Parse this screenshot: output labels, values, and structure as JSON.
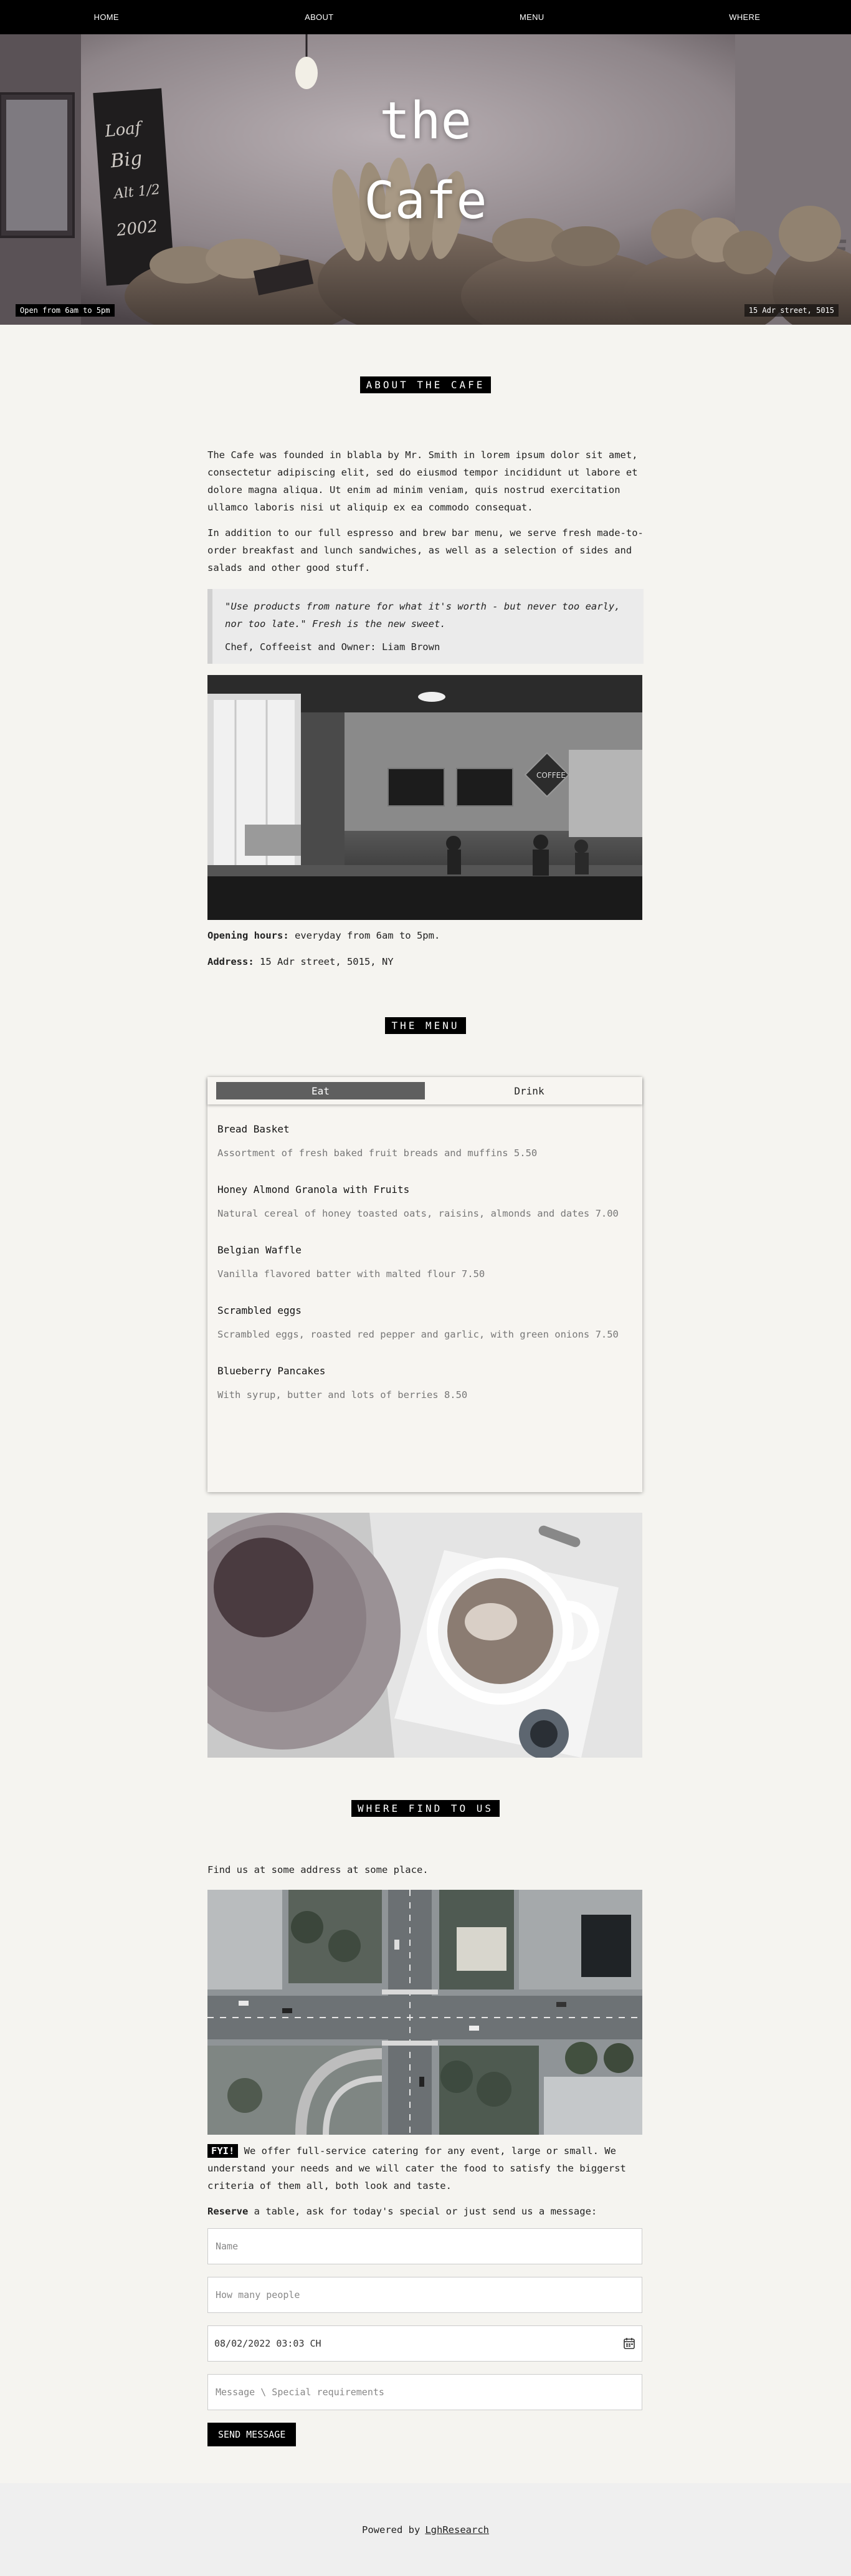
{
  "nav": {
    "home": "HOME",
    "about": "ABOUT",
    "menu": "MENU",
    "where": "WHERE"
  },
  "hero": {
    "title_line1": "the",
    "title_line2": "Cafe",
    "hours_badge": "Open from 6am to 5pm",
    "address_badge": "15 Adr street, 5015"
  },
  "about": {
    "heading": "ABOUT THE CAFE",
    "paragraph1": "The Cafe was founded in blabla by Mr. Smith in lorem ipsum dolor sit amet, consectetur adipiscing elit, sed do eiusmod tempor incididunt ut labore et dolore magna aliqua. Ut enim ad minim veniam, quis nostrud exercitation ullamco laboris nisi ut aliquip ex ea commodo consequat.",
    "paragraph2": "In addition to our full espresso and brew bar menu, we serve fresh made-to-order breakfast and lunch sandwiches, as well as a selection of sides and salads and other good stuff.",
    "quote": "\"Use products from nature for what it's worth - but never too early, nor too late.\" Fresh is the new sweet.",
    "quote_author": "Chef, Coffeeist and Owner: Liam Brown",
    "hours_label": "Opening hours:",
    "hours_value": "everyday from 6am to 5pm.",
    "address_label": "Address:",
    "address_value": "15 Adr street, 5015, NY"
  },
  "menu": {
    "heading": "THE MENU",
    "tabs": [
      {
        "label": "Eat",
        "active": true
      },
      {
        "label": "Drink",
        "active": false
      }
    ],
    "items": [
      {
        "name": "Bread Basket",
        "desc": "Assortment of fresh baked fruit breads and muffins 5.50"
      },
      {
        "name": "Honey Almond Granola with Fruits",
        "desc": "Natural cereal of honey toasted oats, raisins, almonds and dates 7.00"
      },
      {
        "name": "Belgian Waffle",
        "desc": "Vanilla flavored batter with malted flour 7.50"
      },
      {
        "name": "Scrambled eggs",
        "desc": "Scrambled eggs, roasted red pepper and garlic, with green onions 7.50"
      },
      {
        "name": "Blueberry Pancakes",
        "desc": "With syrup, butter and lots of berries 8.50"
      }
    ]
  },
  "where": {
    "heading": "WHERE FIND TO US",
    "intro": "Find us at some address at some place.",
    "fyi_label": "FYI!",
    "fyi_text": "We offer full-service catering for any event, large or small. We understand your needs and we will cater the food to satisfy the biggerst criteria of them all, both look and taste.",
    "reserve_label": "Reserve",
    "reserve_text": "a table, ask for today's special or just send us a message:",
    "form": {
      "name_placeholder": "Name",
      "people_placeholder": "How many people",
      "datetime_value": "08/02/2022 03:03 CH",
      "message_placeholder": "Message \\ Special requirements",
      "send_label": "SEND MESSAGE"
    }
  },
  "footer": {
    "powered_by": "Powered by",
    "link": "LghResearch"
  },
  "icons": {
    "calendar": "calendar-icon"
  }
}
